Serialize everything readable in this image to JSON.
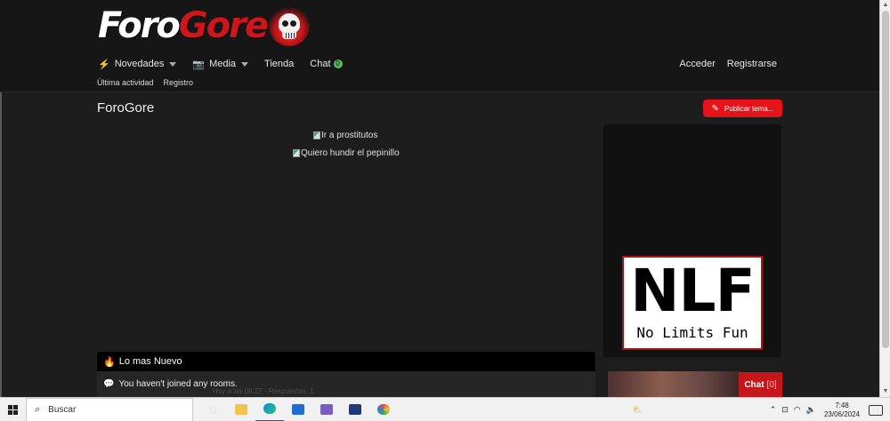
{
  "site": {
    "logo_part1": "Foro",
    "logo_part2": "Gore"
  },
  "nav": {
    "items": [
      {
        "label": "Novedades",
        "icon": "bolt-icon",
        "has_dropdown": true
      },
      {
        "label": "Media",
        "icon": "camera-icon",
        "has_dropdown": true
      },
      {
        "label": "Tienda"
      },
      {
        "label": "Chat",
        "badge": "0"
      }
    ],
    "right": {
      "login": "Acceder",
      "register": "Registrarse"
    },
    "sub": [
      "Última actividad",
      "Registro"
    ]
  },
  "page": {
    "title": "ForoGore",
    "publish_button": "Publicar tema..."
  },
  "main": {
    "broken_images": [
      "Ir a prostitutos",
      "Quiero hundir el pepinillo"
    ]
  },
  "sidebar": {
    "ad_big": "NLF",
    "ad_small": "No Limits Fun"
  },
  "news": {
    "title": "Lo mas Nuevo",
    "rooms_message": "You haven't joined any rooms.",
    "ghost_line": "Hoy a las 08:27 · Respuestas: 1"
  },
  "chat_widget": {
    "label": "Chat",
    "count": "[0]"
  },
  "taskbar": {
    "search_placeholder": "Buscar",
    "time": "7:48",
    "date": "23/06/2024",
    "accent": "#0067c0"
  },
  "colors": {
    "brand_red": "#e8121a",
    "background": "#1d1d1d",
    "badge_green": "#5cb85c"
  }
}
